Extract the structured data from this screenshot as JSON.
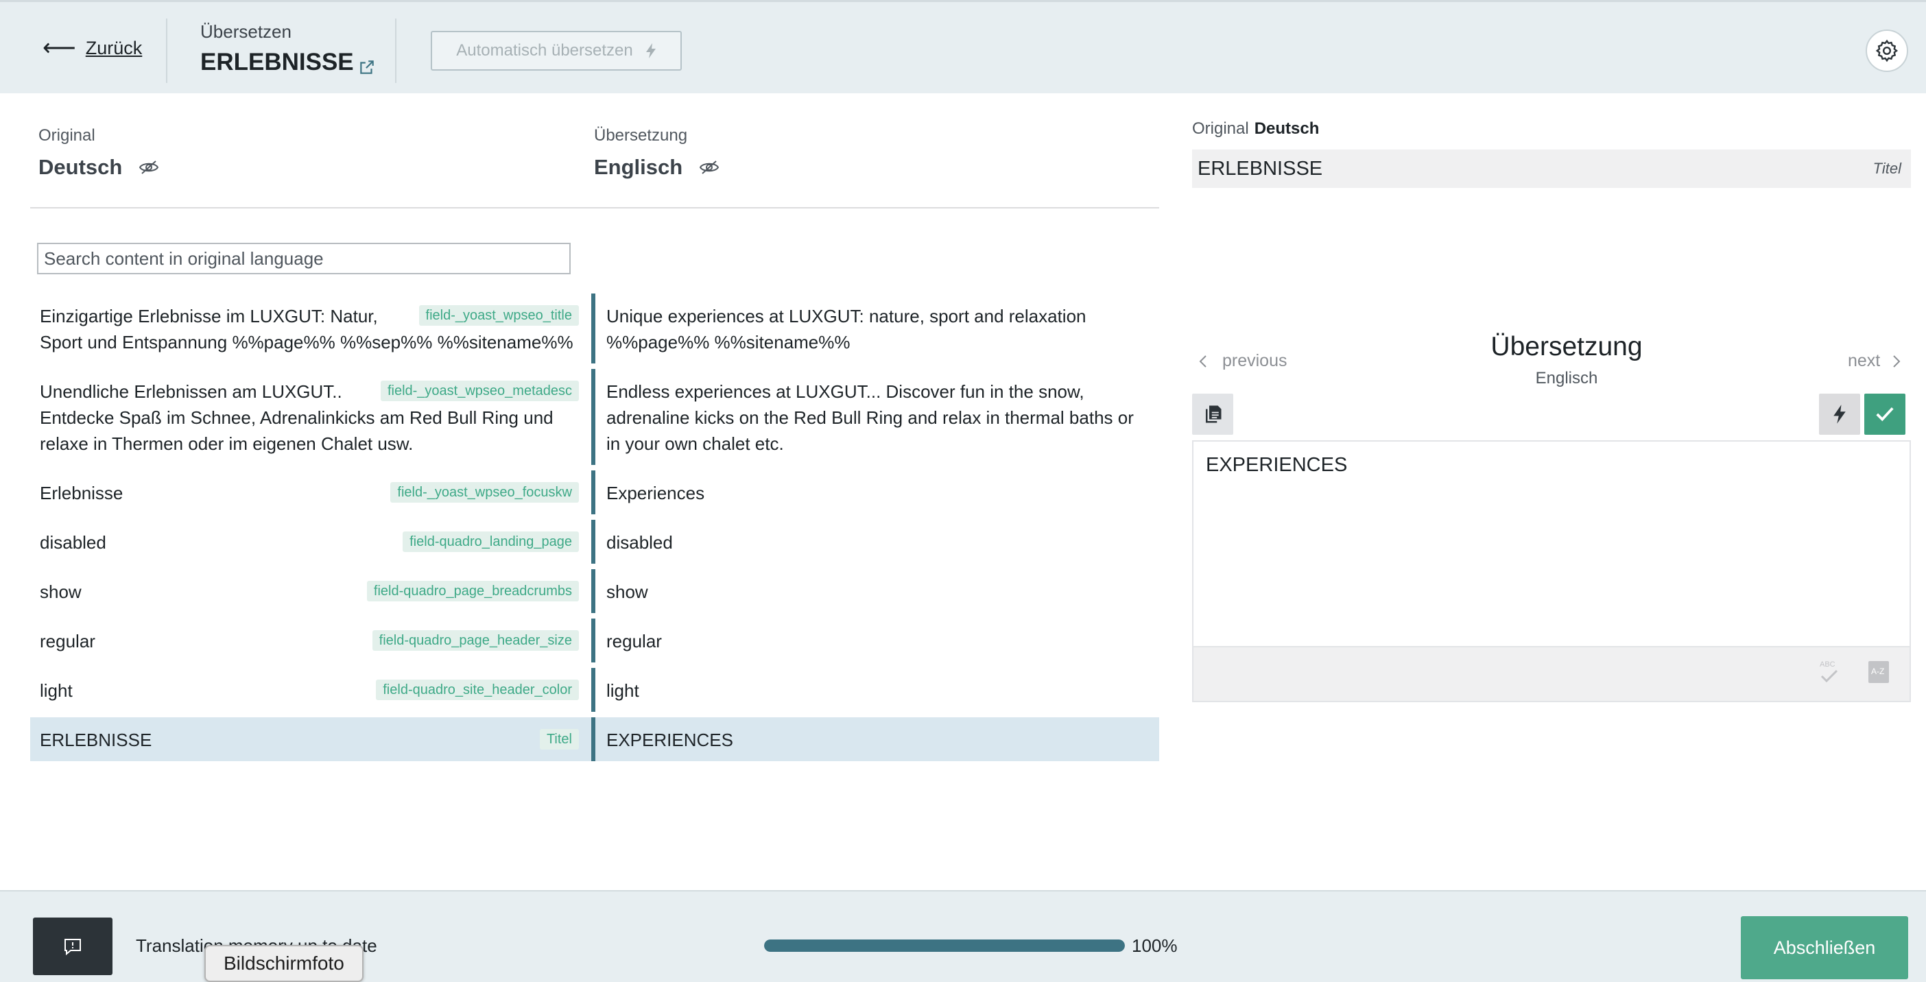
{
  "header": {
    "back_label": "Zurück",
    "subtitle": "Übersetzen",
    "title": "ERLEBNISSE",
    "auto_translate_label": "Automatisch übersetzen"
  },
  "original_column": {
    "caption": "Original",
    "language": "Deutsch"
  },
  "translation_column": {
    "caption": "Übersetzung",
    "language": "Englisch"
  },
  "search": {
    "placeholder": "Search content in original language",
    "value": ""
  },
  "rows": [
    {
      "original": "Einzigartige Erlebnisse im LUXGUT: Natur, Sport und Entspannung %%page%% %%sep%% %%sitename%%",
      "field": "field-_yoast_wpseo_title",
      "translation": "Unique experiences at LUXGUT: nature, sport and relaxation %%page%% %%sitename%%"
    },
    {
      "original": "Unendliche Erlebnissen am LUXGUT.. Entdecke Spaß im Schnee, Adrenalinkicks am Red Bull Ring und relaxe in Thermen oder im eigenen Chalet usw.",
      "field": "field-_yoast_wpseo_metadesc",
      "translation": "Endless experiences at LUXGUT... Discover fun in the snow, adrenaline kicks on the Red Bull Ring and relax in thermal baths or in your own chalet etc."
    },
    {
      "original": "Erlebnisse",
      "field": "field-_yoast_wpseo_focuskw",
      "translation": "Experiences"
    },
    {
      "original": "disabled",
      "field": "field-quadro_landing_page",
      "translation": "disabled"
    },
    {
      "original": "show",
      "field": "field-quadro_page_breadcrumbs",
      "translation": "show"
    },
    {
      "original": "regular",
      "field": "field-quadro_page_header_size",
      "translation": "regular"
    },
    {
      "original": "light",
      "field": "field-quadro_site_header_color",
      "translation": "light"
    },
    {
      "original": "ERLEBNISSE",
      "field": "Titel",
      "translation": "EXPERIENCES",
      "active": true
    }
  ],
  "detail": {
    "original_caption": "Original",
    "original_language": "Deutsch",
    "original_value": "ERLEBNISSE",
    "original_field": "Titel",
    "nav_previous": "previous",
    "nav_next": "next",
    "title": "Übersetzung",
    "language": "Englisch",
    "translation_value": "EXPERIENCES"
  },
  "footer": {
    "memory_status": "Translation memory up to date",
    "progress_percent": 100,
    "progress_label": "100%",
    "finish_label": "Abschließen",
    "tooltip": "Bildschirmfoto"
  },
  "colors": {
    "accent_teal": "#3d7383",
    "tag_green": "#3ea987",
    "finish_green": "#4fa98b",
    "active_row": "#d9e7ef"
  },
  "icons": [
    "arrow-left-icon",
    "external-link-icon",
    "bolt-icon",
    "gear-icon",
    "eye-slash-icon",
    "chevron-left-icon",
    "chevron-right-icon",
    "copy-icon",
    "check-icon",
    "spellcheck-icon",
    "dictionary-icon",
    "feedback-icon"
  ]
}
